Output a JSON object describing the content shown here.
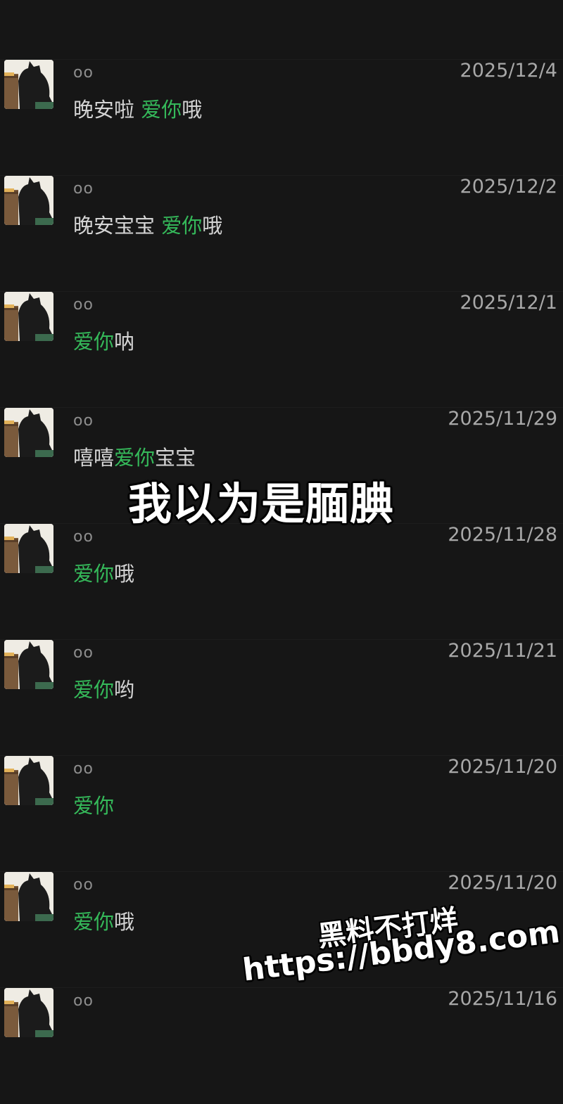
{
  "messages": [
    {
      "sender": "oo",
      "date": "2025/12/4",
      "parts": [
        {
          "t": "晚安啦 ",
          "g": false
        },
        {
          "t": "爱你",
          "g": true
        },
        {
          "t": "哦",
          "g": false
        }
      ]
    },
    {
      "sender": "oo",
      "date": "2025/12/2",
      "parts": [
        {
          "t": "晚安宝宝 ",
          "g": false
        },
        {
          "t": "爱你",
          "g": true
        },
        {
          "t": "哦",
          "g": false
        }
      ]
    },
    {
      "sender": "oo",
      "date": "2025/12/1",
      "parts": [
        {
          "t": "爱你",
          "g": true
        },
        {
          "t": "呐",
          "g": false
        }
      ]
    },
    {
      "sender": "oo",
      "date": "2025/11/29",
      "parts": [
        {
          "t": "嘻嘻",
          "g": false
        },
        {
          "t": "爱你",
          "g": true
        },
        {
          "t": "宝宝",
          "g": false
        }
      ]
    },
    {
      "sender": "oo",
      "date": "2025/11/28",
      "parts": [
        {
          "t": "爱你",
          "g": true
        },
        {
          "t": "哦",
          "g": false
        }
      ]
    },
    {
      "sender": "oo",
      "date": "2025/11/21",
      "parts": [
        {
          "t": "爱你",
          "g": true
        },
        {
          "t": "哟",
          "g": false
        }
      ]
    },
    {
      "sender": "oo",
      "date": "2025/11/20",
      "parts": [
        {
          "t": "爱你",
          "g": true
        }
      ]
    },
    {
      "sender": "oo",
      "date": "2025/11/20",
      "parts": [
        {
          "t": "爱你",
          "g": true
        },
        {
          "t": "哦",
          "g": false
        }
      ]
    },
    {
      "sender": "oo",
      "date": "2025/11/16",
      "parts": []
    }
  ],
  "overlay_caption": "我以为是腼腆",
  "watermark": {
    "line1": "黑料不打烊",
    "line2": "https://bbdy8.com"
  },
  "colors": {
    "background": "#161616",
    "highlight": "#35b95a",
    "text": "#d4d4d4",
    "date": "#a8a8a8"
  }
}
